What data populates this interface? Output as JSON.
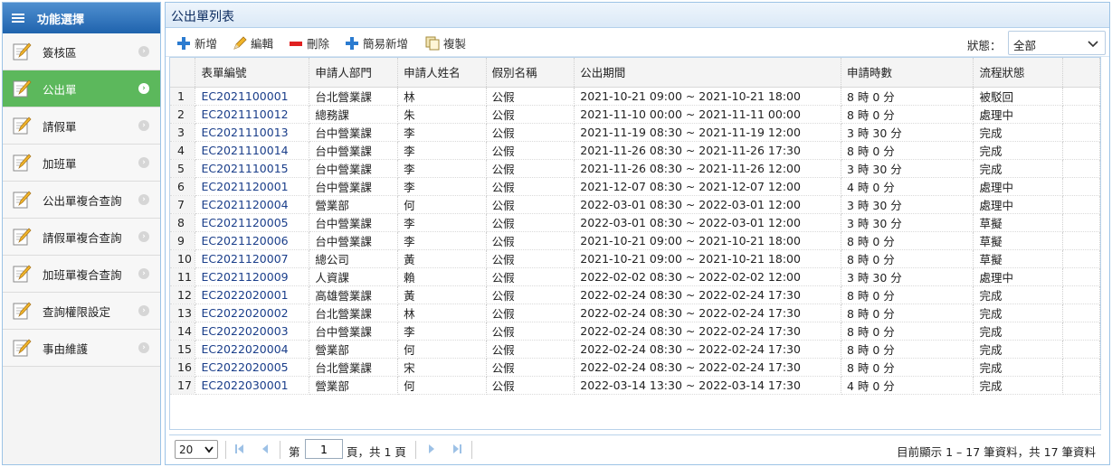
{
  "sidebar": {
    "title": "功能選擇",
    "items": [
      {
        "label": "簽核區",
        "active": false
      },
      {
        "label": "公出單",
        "active": true
      },
      {
        "label": "請假單",
        "active": false
      },
      {
        "label": "加班單",
        "active": false
      },
      {
        "label": "公出單複合查詢",
        "active": false
      },
      {
        "label": "請假單複合查詢",
        "active": false
      },
      {
        "label": "加班單複合查詢",
        "active": false
      },
      {
        "label": "查詢權限設定",
        "active": false
      },
      {
        "label": "事由維護",
        "active": false
      }
    ]
  },
  "main": {
    "title": "公出單列表"
  },
  "toolbar": {
    "add": "新增",
    "edit": "編輯",
    "delete": "刪除",
    "quick_add": "簡易新增",
    "copy": "複製",
    "status_label": "狀態：",
    "status_value": "全部"
  },
  "table": {
    "columns": [
      "表單編號",
      "申請人部門",
      "申請人姓名",
      "假別名稱",
      "公出期間",
      "申請時數",
      "流程狀態"
    ],
    "rows": [
      {
        "n": "1",
        "code": "EC2021100001",
        "dept": "台北營業課",
        "name": "林",
        "type": "公假",
        "period": "2021-10-21 09:00 ~ 2021-10-21 18:00",
        "hours": "8 時 0 分",
        "status": "被駁回"
      },
      {
        "n": "2",
        "code": "EC2021110012",
        "dept": "總務課",
        "name": "朱",
        "type": "公假",
        "period": "2021-11-10 00:00 ~ 2021-11-11 00:00",
        "hours": "8 時 0 分",
        "status": "處理中"
      },
      {
        "n": "3",
        "code": "EC2021110013",
        "dept": "台中營業課",
        "name": "李",
        "type": "公假",
        "period": "2021-11-19 08:30 ~ 2021-11-19 12:00",
        "hours": "3 時 30 分",
        "status": "完成"
      },
      {
        "n": "4",
        "code": "EC2021110014",
        "dept": "台中營業課",
        "name": "李",
        "type": "公假",
        "period": "2021-11-26 08:30 ~ 2021-11-26 17:30",
        "hours": "8 時 0 分",
        "status": "完成"
      },
      {
        "n": "5",
        "code": "EC2021110015",
        "dept": "台中營業課",
        "name": "李",
        "type": "公假",
        "period": "2021-11-26 08:30 ~ 2021-11-26 12:00",
        "hours": "3 時 30 分",
        "status": "完成"
      },
      {
        "n": "6",
        "code": "EC2021120001",
        "dept": "台中營業課",
        "name": "李",
        "type": "公假",
        "period": "2021-12-07 08:30 ~ 2021-12-07 12:00",
        "hours": "4 時 0 分",
        "status": "處理中"
      },
      {
        "n": "7",
        "code": "EC2021120004",
        "dept": "營業部",
        "name": "何",
        "type": "公假",
        "period": "2022-03-01 08:30 ~ 2022-03-01 12:00",
        "hours": "3 時 30 分",
        "status": "處理中"
      },
      {
        "n": "8",
        "code": "EC2021120005",
        "dept": "台中營業課",
        "name": "李",
        "type": "公假",
        "period": "2022-03-01 08:30 ~ 2022-03-01 12:00",
        "hours": "3 時 30 分",
        "status": "草擬"
      },
      {
        "n": "9",
        "code": "EC2021120006",
        "dept": "台中營業課",
        "name": "李",
        "type": "公假",
        "period": "2021-10-21 09:00 ~ 2021-10-21 18:00",
        "hours": "8 時 0 分",
        "status": "草擬"
      },
      {
        "n": "10",
        "code": "EC2021120007",
        "dept": "總公司",
        "name": "黃",
        "type": "公假",
        "period": "2021-10-21 09:00 ~ 2021-10-21 18:00",
        "hours": "8 時 0 分",
        "status": "草擬"
      },
      {
        "n": "11",
        "code": "EC2021120009",
        "dept": "人資課",
        "name": "賴",
        "type": "公假",
        "period": "2022-02-02 08:30 ~ 2022-02-02 12:00",
        "hours": "3 時 30 分",
        "status": "處理中"
      },
      {
        "n": "12",
        "code": "EC2022020001",
        "dept": "高雄營業課",
        "name": "黃",
        "type": "公假",
        "period": "2022-02-24 08:30 ~ 2022-02-24 17:30",
        "hours": "8 時 0 分",
        "status": "完成"
      },
      {
        "n": "13",
        "code": "EC2022020002",
        "dept": "台北營業課",
        "name": "林",
        "type": "公假",
        "period": "2022-02-24 08:30 ~ 2022-02-24 17:30",
        "hours": "8 時 0 分",
        "status": "完成"
      },
      {
        "n": "14",
        "code": "EC2022020003",
        "dept": "台中營業課",
        "name": "李",
        "type": "公假",
        "period": "2022-02-24 08:30 ~ 2022-02-24 17:30",
        "hours": "8 時 0 分",
        "status": "完成"
      },
      {
        "n": "15",
        "code": "EC2022020004",
        "dept": "營業部",
        "name": "何",
        "type": "公假",
        "period": "2022-02-24 08:30 ~ 2022-02-24 17:30",
        "hours": "8 時 0 分",
        "status": "完成"
      },
      {
        "n": "16",
        "code": "EC2022020005",
        "dept": "台北營業課",
        "name": "宋",
        "type": "公假",
        "period": "2022-02-24 08:30 ~ 2022-02-24 17:30",
        "hours": "8 時 0 分",
        "status": "完成"
      },
      {
        "n": "17",
        "code": "EC2022030001",
        "dept": "營業部",
        "name": "何",
        "type": "公假",
        "period": "2022-03-14 13:30 ~ 2022-03-14 17:30",
        "hours": "4 時 0 分",
        "status": "完成"
      }
    ]
  },
  "pager": {
    "page_size": "20",
    "label_pre": "第",
    "page_value": "1",
    "label_post": "頁，共 1 頁",
    "info": "目前顯示 1 – 17 筆資料，共 17 筆資料"
  },
  "colors": {
    "header_blue": "#1f63ad",
    "active_green": "#5cb85c",
    "link_blue": "#1a3e8a"
  }
}
